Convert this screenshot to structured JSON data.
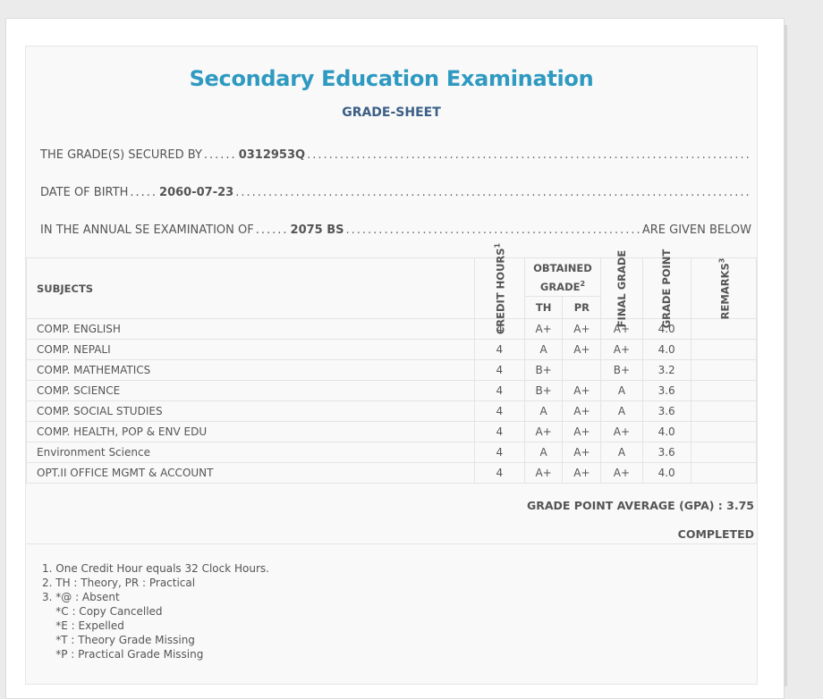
{
  "header": {
    "title": "Secondary Education Examination",
    "subtitle": "GRADE-SHEET"
  },
  "info": {
    "secured_by_label": "THE GRADE(S) SECURED BY",
    "symbol_no": "0312953Q",
    "dob_label": "DATE OF BIRTH",
    "dob": "2060-07-23",
    "exam_label": "IN THE ANNUAL SE EXAMINATION OF",
    "exam_year": "2075 BS",
    "given_below": "ARE GIVEN BELOW"
  },
  "table": {
    "headers": {
      "subjects": "SUBJECTS",
      "credit_hours": "CREDIT HOURS",
      "credit_hours_sup": "1",
      "obtained_grade": "OBTAINED GRADE",
      "obtained_grade_sup": "2",
      "th": "TH",
      "pr": "PR",
      "final_grade": "FINAL GRADE",
      "grade_point": "GRADE POINT",
      "remarks": "REMARKS",
      "remarks_sup": "3"
    },
    "rows": [
      {
        "subject": "COMP. ENGLISH",
        "credit": "4",
        "th": "A+",
        "pr": "A+",
        "final": "A+",
        "gp": "4.0",
        "remarks": ""
      },
      {
        "subject": "COMP. NEPALI",
        "credit": "4",
        "th": "A",
        "pr": "A+",
        "final": "A+",
        "gp": "4.0",
        "remarks": ""
      },
      {
        "subject": "COMP. MATHEMATICS",
        "credit": "4",
        "th": "B+",
        "pr": "",
        "final": "B+",
        "gp": "3.2",
        "remarks": ""
      },
      {
        "subject": "COMP. SCIENCE",
        "credit": "4",
        "th": "B+",
        "pr": "A+",
        "final": "A",
        "gp": "3.6",
        "remarks": ""
      },
      {
        "subject": "COMP. SOCIAL STUDIES",
        "credit": "4",
        "th": "A",
        "pr": "A+",
        "final": "A",
        "gp": "3.6",
        "remarks": ""
      },
      {
        "subject": "COMP. HEALTH, POP & ENV EDU",
        "credit": "4",
        "th": "A+",
        "pr": "A+",
        "final": "A+",
        "gp": "4.0",
        "remarks": ""
      },
      {
        "subject": "Environment Science",
        "credit": "4",
        "th": "A",
        "pr": "A+",
        "final": "A",
        "gp": "3.6",
        "remarks": ""
      },
      {
        "subject": "OPT.II OFFICE MGMT & ACCOUNT",
        "credit": "4",
        "th": "A+",
        "pr": "A+",
        "final": "A+",
        "gp": "4.0",
        "remarks": ""
      }
    ]
  },
  "summary": {
    "gpa_text": "GRADE POINT AVERAGE (GPA) : 3.75",
    "status": "COMPLETED"
  },
  "notes": [
    "1. One Credit Hour equals 32 Clock Hours.",
    "2. TH : Theory, PR : Practical",
    "3. *@ : Absent",
    "    *C : Copy Cancelled",
    "    *E : Expelled",
    "    *T : Theory Grade Missing",
    "    *P : Practical Grade Missing"
  ],
  "colors": {
    "title": "#2f9ac1",
    "subtitle": "#3b5f86"
  }
}
